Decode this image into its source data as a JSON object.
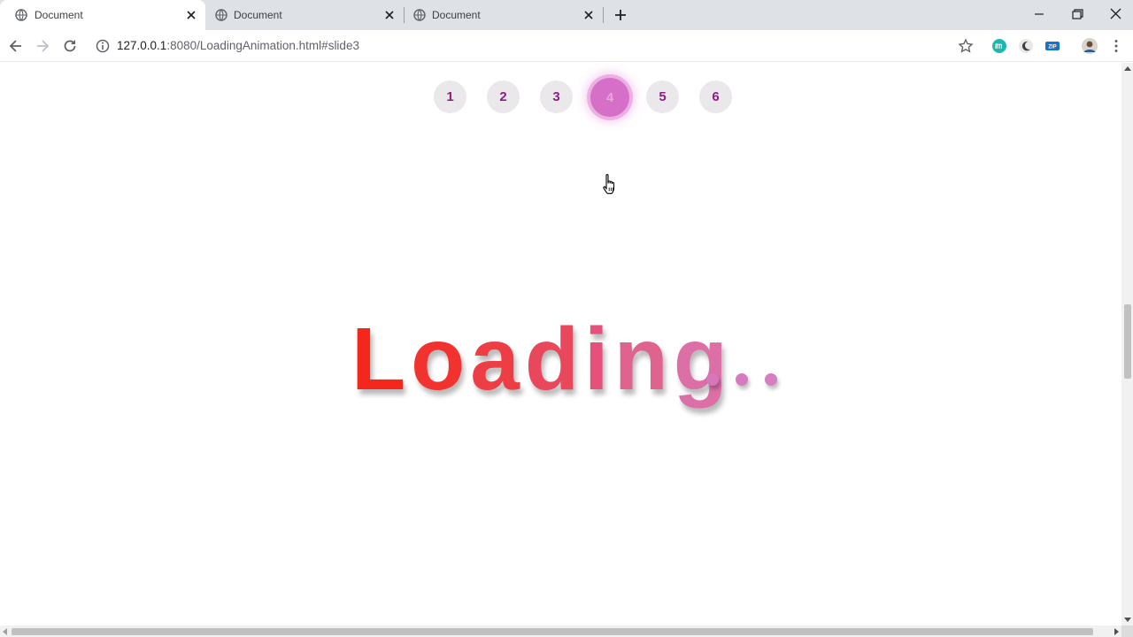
{
  "browser": {
    "tabs": [
      {
        "title": "Document",
        "active": true
      },
      {
        "title": "Document",
        "active": false
      },
      {
        "title": "Document",
        "active": false
      }
    ],
    "url_host": "127.0.0.1",
    "url_rest": ":8080/LoadingAnimation.html#slide3"
  },
  "slides": {
    "items": [
      "1",
      "2",
      "3",
      "4",
      "5",
      "6"
    ],
    "active_index": 3
  },
  "loading": {
    "word": "Loading",
    "letters": [
      "L",
      "o",
      "a",
      "d",
      "i",
      "n",
      "g"
    ],
    "letter_colors": [
      "#f4271d",
      "#f2322f",
      "#ee3e45",
      "#e9475b",
      "#e5517a",
      "#e0628f",
      "#dd6fa7"
    ],
    "dot_colors": [
      "#d777bb",
      "#d77bbf",
      "#d77dc2"
    ]
  },
  "colors": {
    "accent": "#d56fc7",
    "dot_text": "#8b1f86"
  }
}
